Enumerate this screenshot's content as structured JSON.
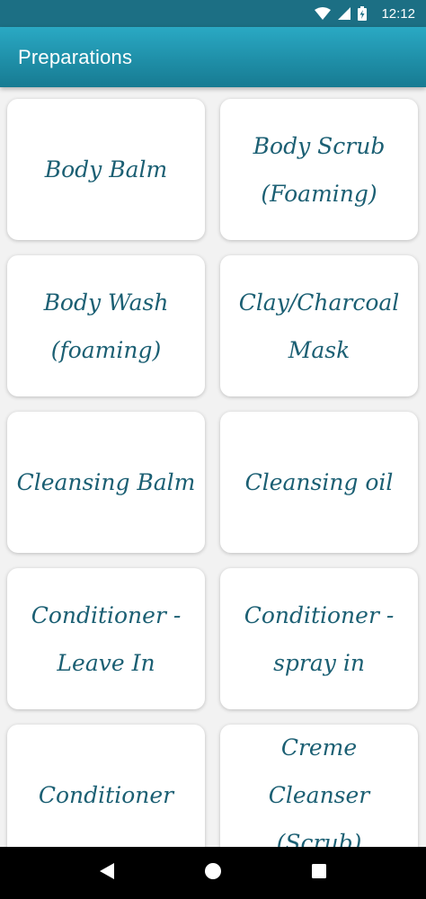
{
  "status_bar": {
    "time": "12:12",
    "icons": [
      "wifi-icon",
      "cell-signal-icon",
      "battery-charging-icon"
    ]
  },
  "app_bar": {
    "title": "Preparations"
  },
  "colors": {
    "status_bar": "#1c6f84",
    "app_bar": "#1f8fa8",
    "card_text": "#1b5f73",
    "background": "#f2f2f2"
  },
  "preparations": [
    {
      "label": "Body Balm"
    },
    {
      "label": "Body Scrub\n(Foaming)"
    },
    {
      "label": "Body Wash\n(foaming)"
    },
    {
      "label": "Clay/Charcoal\nMask"
    },
    {
      "label": "Cleansing Balm"
    },
    {
      "label": "Cleansing oil"
    },
    {
      "label": "Conditioner -\nLeave In"
    },
    {
      "label": "Conditioner -\nspray in"
    },
    {
      "label": "Conditioner"
    },
    {
      "label": "Creme Cleanser\n(Scrub)"
    }
  ],
  "nav_bar": {
    "buttons": [
      "back-icon",
      "home-icon",
      "recents-icon"
    ]
  }
}
